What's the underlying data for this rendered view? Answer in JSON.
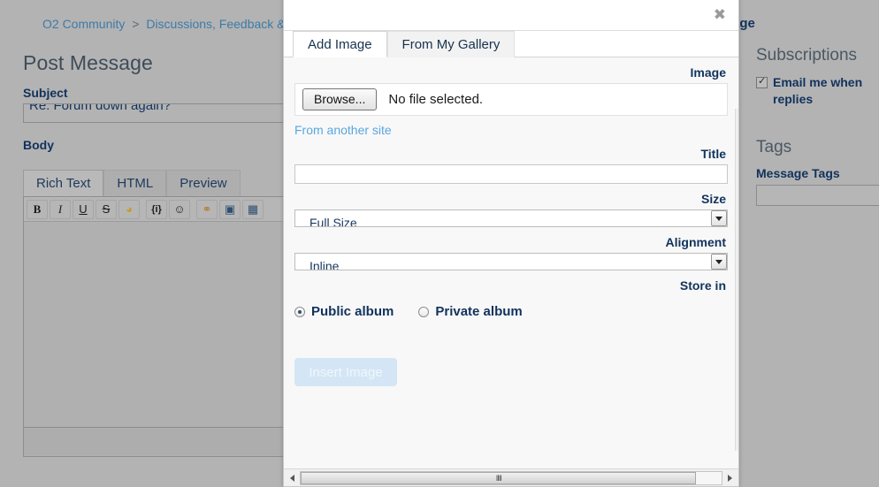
{
  "page": {
    "breadcrumb": {
      "items": [
        "O2 Community",
        "Discussions, Feedback &"
      ],
      "separator": ">"
    },
    "title": "Post Message",
    "title_right_fragment": "age",
    "subject": {
      "label": "Subject",
      "value": "Re: Forum down again?"
    },
    "body": {
      "label": "Body"
    },
    "editor_tabs": [
      {
        "label": "Rich Text",
        "active": true
      },
      {
        "label": "HTML",
        "active": false
      },
      {
        "label": "Preview",
        "active": false
      }
    ],
    "toolbar": [
      {
        "name": "bold-icon",
        "glyph": "B"
      },
      {
        "name": "italic-icon",
        "glyph": "I"
      },
      {
        "name": "underline-icon",
        "glyph": "U"
      },
      {
        "name": "strikethrough-icon",
        "glyph": "S"
      },
      {
        "name": "font-color-icon",
        "glyph": "◕"
      },
      {
        "name": "insert-variable-icon",
        "glyph": "{i}"
      },
      {
        "name": "emoticon-icon",
        "glyph": "☺"
      },
      {
        "name": "link-icon",
        "glyph": "⚭"
      },
      {
        "name": "image-icon",
        "glyph": "▣"
      },
      {
        "name": "video-icon",
        "glyph": "▦"
      }
    ]
  },
  "sidebar": {
    "subscriptions_heading": "Subscriptions",
    "subscribe_label": "Email me when\nreplies",
    "subscribe_checked": true,
    "tags_heading": "Tags",
    "message_tags_label": "Message Tags",
    "message_tags_value": ""
  },
  "modal": {
    "close_label": "✖",
    "tabs": [
      {
        "label": "Add Image",
        "active": true
      },
      {
        "label": "From My Gallery",
        "active": false
      }
    ],
    "image": {
      "label": "Image",
      "browse_label": "Browse...",
      "file_status": "No file selected.",
      "from_another_site": "From another site"
    },
    "title_field": {
      "label": "Title",
      "value": "",
      "placeholder": ""
    },
    "size_field": {
      "label": "Size",
      "value": "Full Size"
    },
    "alignment_field": {
      "label": "Alignment",
      "value": "Inline"
    },
    "store_in": {
      "label": "Store in",
      "options": [
        {
          "label": "Public album",
          "selected": true
        },
        {
          "label": "Private album",
          "selected": false
        }
      ]
    },
    "insert_button": {
      "label": "Insert Image",
      "disabled": true
    },
    "scrollbar": {
      "grip": "IIII"
    }
  },
  "colors": {
    "page_bg": "#b3b3b3",
    "modal_bg": "#ffffff",
    "body_bg": "#f8f8f8",
    "label_navy": "#11325c",
    "link_blue": "#5aa7e0",
    "breadcrumb_blue": "#3d7ba8",
    "disabled_button": "#d4e6f5"
  }
}
